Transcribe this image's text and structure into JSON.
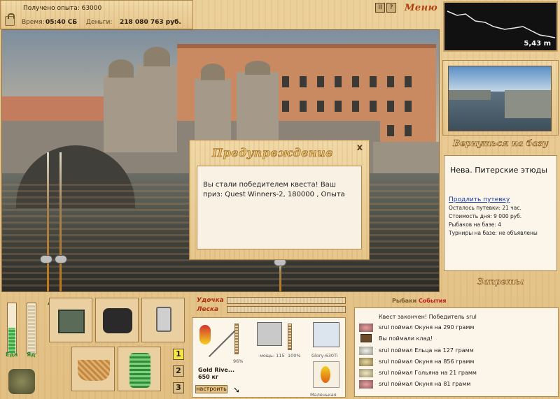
{
  "status": {
    "experience": "Получено опыта: 63000",
    "time_label": "Время:",
    "time_value": "05:40 СБ",
    "money_label": "Деньги:",
    "money_value": "218 080 763 руб."
  },
  "top_buttons": [
    "II",
    "?"
  ],
  "menu_label": "Меню",
  "dialog": {
    "title": "Предупреждение",
    "close": "x",
    "message": "Вы стали победителем квеста! Ваш приз: Quest Winners-2, 180000 , Опыта"
  },
  "depth": {
    "value": "5,43 m"
  },
  "return_label": "Вернуться на базу",
  "info": {
    "location": "Нева. Питерские этюды",
    "extend_link": "Продлить путевку",
    "lines": [
      "Осталось путевки: 21 час.",
      "Стоимость дня: 9 000 руб.",
      "Рыбаков на базе: 4",
      "Турниры на базе: не объявлены"
    ]
  },
  "bans_label": "Запреты",
  "meters": {
    "food_label": "Еда",
    "drink_label": "Яд"
  },
  "slots": [
    "tackle-box",
    "backpack",
    "phone",
    "bait-basket",
    "keepnet"
  ],
  "rod_numbers": [
    "1",
    "2",
    "3"
  ],
  "active_rod": "1",
  "tackle": {
    "rod_label": "Удочка",
    "line_label": "Леска",
    "rod_name": "Gold Rive...",
    "rod_weight": "650 кг",
    "rod_percent": "96%",
    "reel_power": "мощь: 115",
    "reel_percent": "100%",
    "line_name": "Glory-630Ti",
    "bait_name": "Маленькая",
    "setup_button": "настроить"
  },
  "events": {
    "title_part1": "Рыбаки",
    "title_part2": "События",
    "items": [
      "Квест закончен! Победитель srul",
      "srul поймал Окуня на 290 грамм",
      "Вы поймали клад!",
      "srul поймал Ельца на 127 грамм",
      "srul поймал Окуня на 856 грамм",
      "srul поймал Гольяна на 21 грамм",
      "srul поймал Окуня на 81 грамм"
    ]
  },
  "colors": {
    "accent": "#b04010",
    "active_rod": "#f4e64a",
    "link": "#1a3aa8",
    "meter_green": "#2d8a2d"
  }
}
